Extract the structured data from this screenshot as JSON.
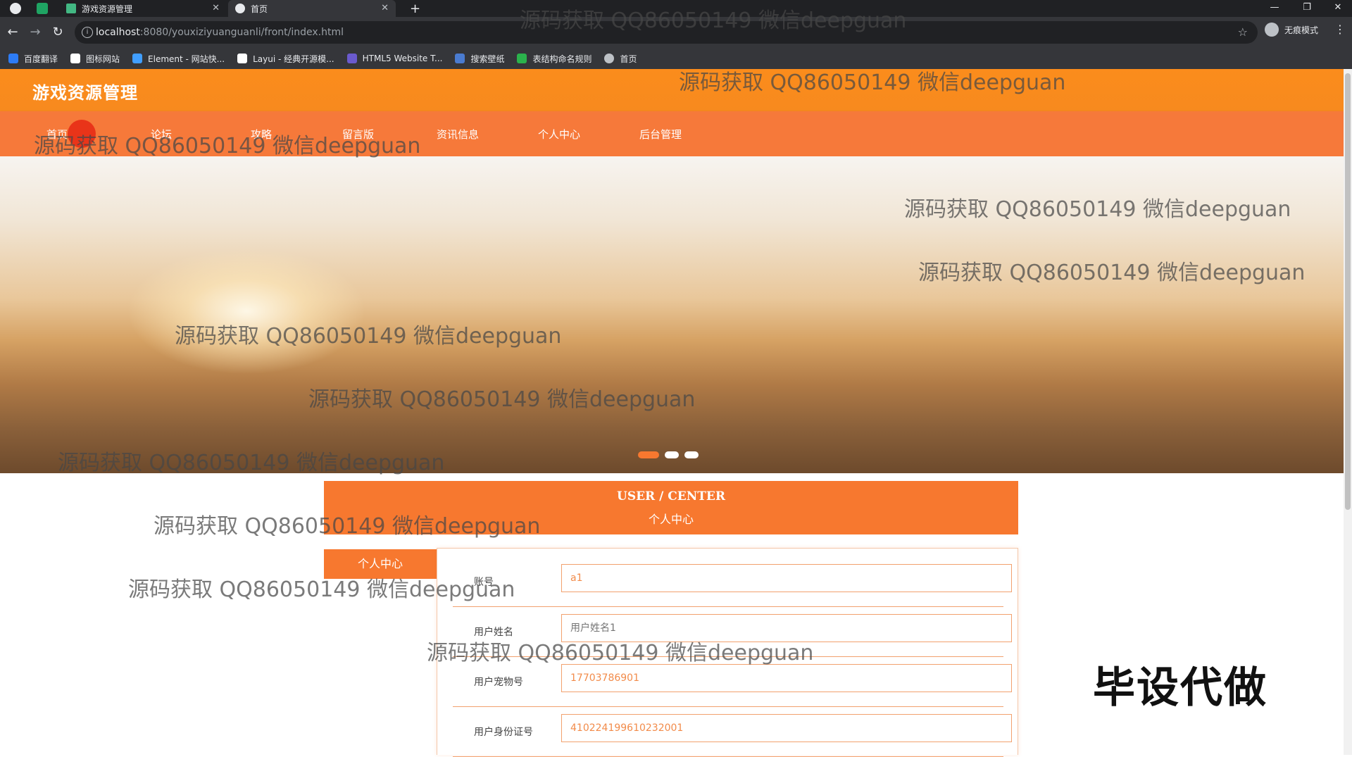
{
  "browser": {
    "tabs": [
      {
        "title": "游戏资源管理"
      },
      {
        "title": "首页"
      }
    ],
    "new_tab": "+",
    "url_host": "localhost",
    "url_path": ":8080/youxiziyuanguanli/front/index.html",
    "profile_label": "无痕模式",
    "bookmarks": [
      {
        "label": "百度翻译",
        "color": "#2d7cf6"
      },
      {
        "label": "图标网站",
        "color": "#ffffff"
      },
      {
        "label": "Element - 网站快...",
        "color": "#409eff"
      },
      {
        "label": "Layui - 经典开源模...",
        "color": "#ffffff"
      },
      {
        "label": "HTML5 Website T...",
        "color": "#6a5acd"
      },
      {
        "label": "搜索壁纸",
        "color": "#4a7bd0"
      },
      {
        "label": "表结构命名规则",
        "color": "#2bb24c"
      },
      {
        "label": "首页",
        "color": "#bdc1c6"
      }
    ]
  },
  "site": {
    "title": "游戏资源管理",
    "nav": [
      "首页",
      "论坛",
      "攻略",
      "留言版",
      "资讯信息",
      "个人中心",
      "后台管理"
    ],
    "accent": "#f7782f"
  },
  "carousel": {
    "slides": 3,
    "active": 1
  },
  "user_center": {
    "title_en": "USER / CENTER",
    "title_cn": "个人中心",
    "side_tab": "个人中心",
    "fields": [
      {
        "label": "账号",
        "value": "a1",
        "placeholder": ""
      },
      {
        "label": "用户姓名",
        "value": "",
        "placeholder": "用户姓名1"
      },
      {
        "label": "用户宠物号",
        "value": "17703786901",
        "placeholder": ""
      },
      {
        "label": "用户身份证号",
        "value": "410224199610232001",
        "placeholder": ""
      }
    ]
  },
  "watermark": "源码获取 QQ86050149 微信deepguan",
  "badge": "毕设代做"
}
